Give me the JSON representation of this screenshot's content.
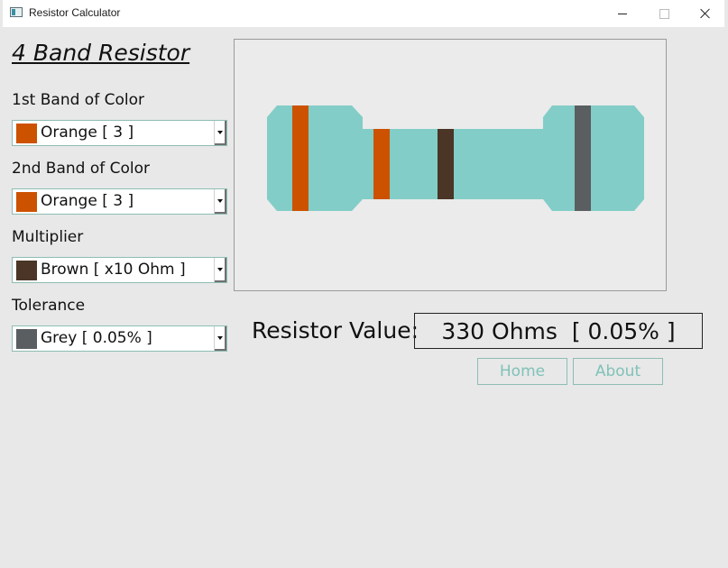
{
  "window": {
    "title": "Resistor Calculator",
    "app_icon": "window-app-icon"
  },
  "heading": "4 Band Resistor",
  "bands": [
    {
      "label": "1st Band of Color",
      "selected": "Orange [ 3 ]",
      "color": "#cc5200"
    },
    {
      "label": "2nd Band of Color",
      "selected": "Orange [ 3 ]",
      "color": "#cc5200"
    },
    {
      "label": "Multiplier",
      "selected": "Brown [ x10 Ohm ]",
      "color": "#4a3526"
    },
    {
      "label": "Tolerance",
      "selected": "Grey [ 0.05% ]",
      "color": "#5a5e61"
    }
  ],
  "resistor_colors": {
    "body": "#82cdc7",
    "band1": "#cc5200",
    "band2": "#cc5200",
    "multiplier": "#4a3526",
    "tolerance": "#5a5e61"
  },
  "result": {
    "label": "Resistor Value:",
    "value": "330 Ohms  [ 0.05% ]"
  },
  "buttons": {
    "home": "Home",
    "about": "About"
  },
  "icons": {
    "dropdown": "chevron-down-icon",
    "minimize": "minimize-icon",
    "maximize": "maximize-icon",
    "close": "close-icon"
  }
}
